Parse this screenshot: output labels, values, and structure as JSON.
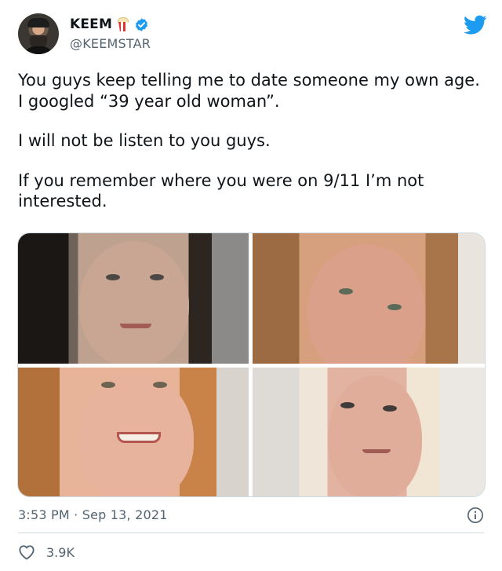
{
  "tweet": {
    "display_name": "KEEM",
    "handle": "@KEEMSTAR",
    "paragraphs": [
      "You guys keep telling me to date someone my own age. I googled “39 year old woman”.",
      "I will not be listen to you guys.",
      "If you remember where you were on 9/11 I’m not interested."
    ],
    "timestamp": "3:53 PM · Sep 13, 2021",
    "likes": "3.9K"
  },
  "icons": {
    "name_emoji": "popcorn-icon",
    "verified": "verified-badge-icon",
    "platform": "twitter-bird-icon",
    "info": "info-icon",
    "like": "heart-icon"
  },
  "colors": {
    "accent": "#1d9bf0",
    "text": "#0f1419",
    "secondary": "#536471",
    "border": "#cfd9de"
  }
}
